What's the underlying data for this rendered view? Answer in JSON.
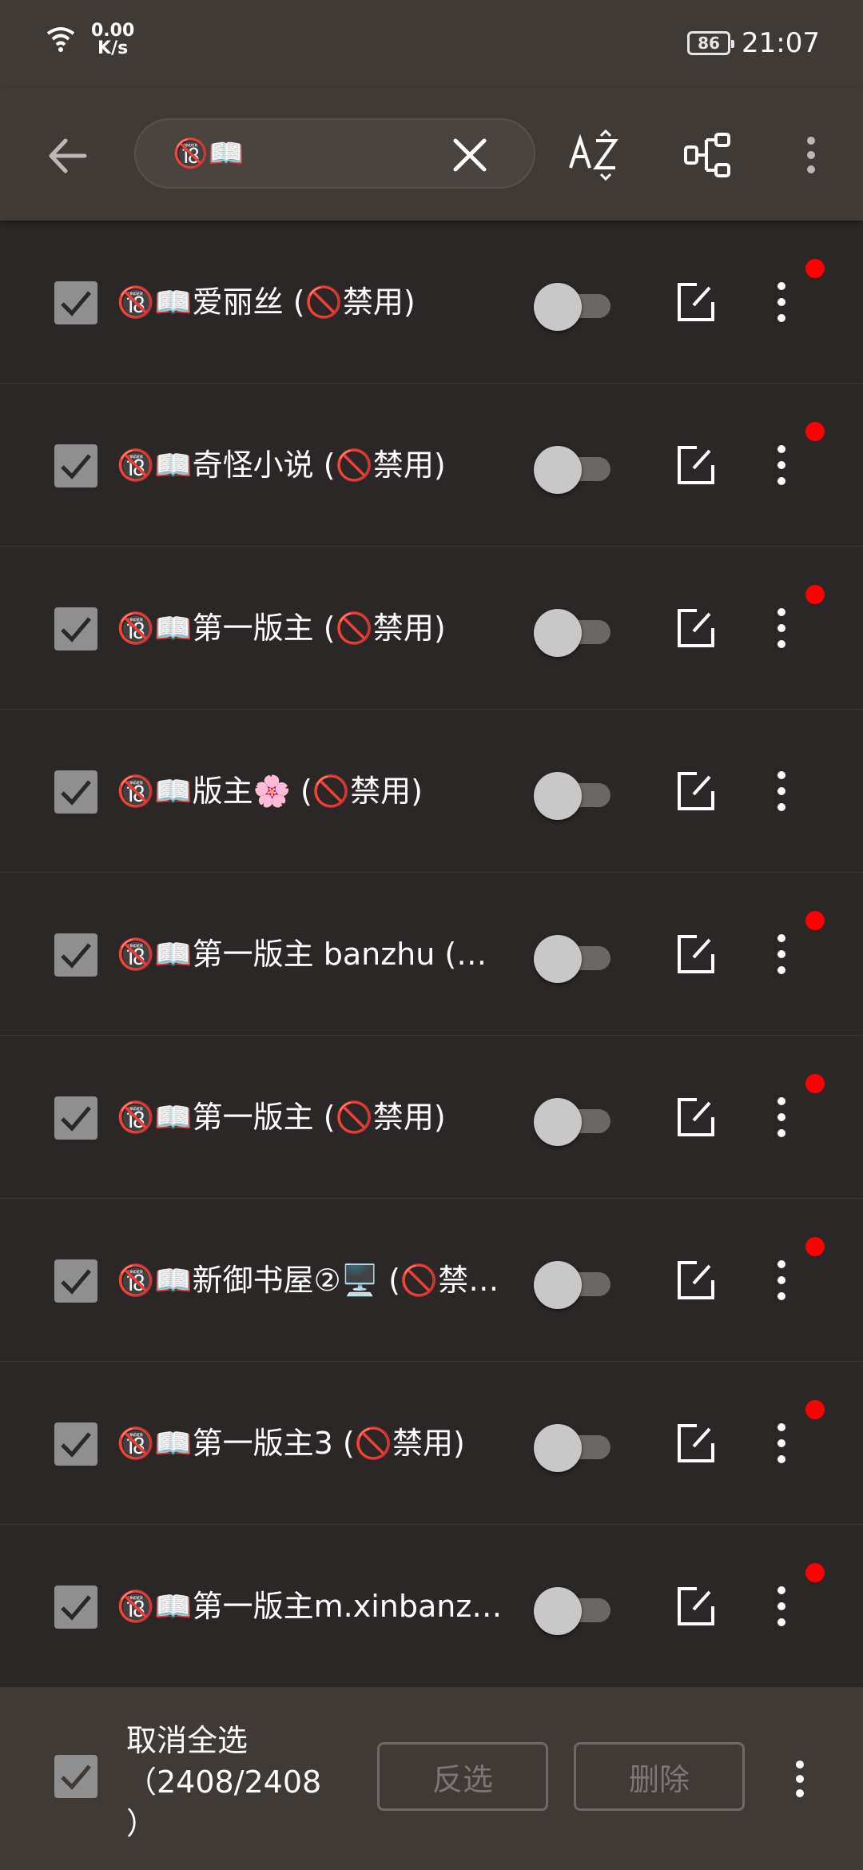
{
  "status_bar": {
    "network_speed_value": "0.00",
    "network_speed_unit": "K/s",
    "battery": "86",
    "time": "21:07"
  },
  "toolbar": {
    "search_value": "🔞📖",
    "back_icon": "arrow-left-icon",
    "clear_icon": "close-icon",
    "sort_icon": "sort-az-icon",
    "group_icon": "group-tree-icon",
    "menu_icon": "more-vert-icon"
  },
  "sources": [
    {
      "name": "🔞📖爱丽丝 (🚫禁用)",
      "checked": true,
      "enabled": false,
      "has_badge": true
    },
    {
      "name": "🔞📖奇怪小说 (🚫禁用)",
      "checked": true,
      "enabled": false,
      "has_badge": true
    },
    {
      "name": "🔞📖第一版主 (🚫禁用)",
      "checked": true,
      "enabled": false,
      "has_badge": true
    },
    {
      "name": "🔞📖版主🌸 (🚫禁用)",
      "checked": true,
      "enabled": false,
      "has_badge": false
    },
    {
      "name": "🔞📖第一版主 banzhu (…",
      "checked": true,
      "enabled": false,
      "has_badge": true
    },
    {
      "name": "🔞📖第一版主 (🚫禁用)",
      "checked": true,
      "enabled": false,
      "has_badge": true
    },
    {
      "name": "🔞📖新御书屋②🖥️ (🚫禁…",
      "checked": true,
      "enabled": false,
      "has_badge": true
    },
    {
      "name": "🔞📖第一版主3 (🚫禁用)",
      "checked": true,
      "enabled": false,
      "has_badge": true
    },
    {
      "name": "🔞📖第一版主m.xinbanz…",
      "checked": true,
      "enabled": false,
      "has_badge": true
    }
  ],
  "bottom_bar": {
    "select_all_label": "取消全选\n（2408/2408\n）",
    "invert_label": "反选",
    "delete_label": "删除"
  },
  "colors": {
    "toolbar_bg": "#403a37",
    "list_bg": "#2b2726",
    "badge": "#ff0000",
    "checkbox": "#8f8f8f"
  }
}
